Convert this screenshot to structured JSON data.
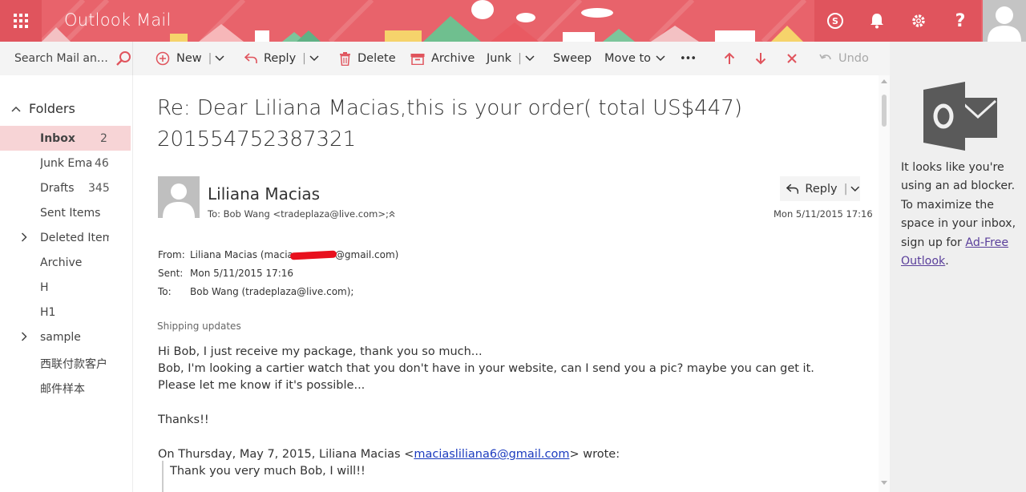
{
  "header": {
    "app_title": "Outlook Mail"
  },
  "toolbar": {
    "search_placeholder": "Search Mail and People",
    "new_label": "New",
    "reply_label": "Reply",
    "delete_label": "Delete",
    "archive_label": "Archive",
    "junk_label": "Junk",
    "sweep_label": "Sweep",
    "moveto_label": "Move to",
    "more_label": "•••",
    "undo_label": "Undo"
  },
  "nav": {
    "folders_label": "Folders",
    "items": [
      {
        "label": "Inbox",
        "count": "2"
      },
      {
        "label": "Junk Email",
        "count": "46"
      },
      {
        "label": "Drafts",
        "count": "345"
      },
      {
        "label": "Sent Items",
        "count": ""
      },
      {
        "label": "Deleted Items",
        "count": ""
      },
      {
        "label": "Archive",
        "count": ""
      },
      {
        "label": "H",
        "count": ""
      },
      {
        "label": "H1",
        "count": ""
      },
      {
        "label": "sample",
        "count": ""
      },
      {
        "label": "西联付款客户",
        "count": ""
      },
      {
        "label": "邮件样本",
        "count": ""
      }
    ]
  },
  "message": {
    "subject": "Re: Dear Liliana Macias,this is your order( total US$447) 201554752387321",
    "sender_name": "Liliana Macias",
    "to_line": "To: Bob Wang <tradeplaza@live.com>;",
    "reply_label": "Reply",
    "date": "Mon 5/11/2015 17:16",
    "headers": {
      "from_key": "From:",
      "from_pre": "Liliana Macias (macia",
      "from_post": "@gmail.com)",
      "sent_key": "Sent:",
      "sent_val": "Mon 5/11/2015 17:16",
      "to_key": "To:",
      "to_val": "Bob Wang (tradeplaza@live.com);"
    },
    "section_note": "Shipping updates",
    "body_lines": [
      "Hi Bob, I just receive my package, thank you so much...",
      "Bob, I'm looking a cartier watch that you don't have in your website, can I send you a pic? maybe you can get it.",
      "Please let me know if it's possible...",
      "Thanks!!"
    ],
    "quote_intro_pre": "On Thursday, May 7, 2015, Liliana Macias <",
    "quote_email": "maciasliliana6@gmail.com",
    "quote_intro_post": "> wrote:",
    "quote_line": "Thank you very much Bob, I will!!"
  },
  "ad": {
    "text": "It looks like you're using an ad blocker. To maximize the space in your inbox, sign up for ",
    "link": "Ad-Free Outlook",
    "tail": "."
  },
  "colors": {
    "header": "#e8636b",
    "selected": "#f7d4d6",
    "toolbar_accent": "#e0545d"
  }
}
